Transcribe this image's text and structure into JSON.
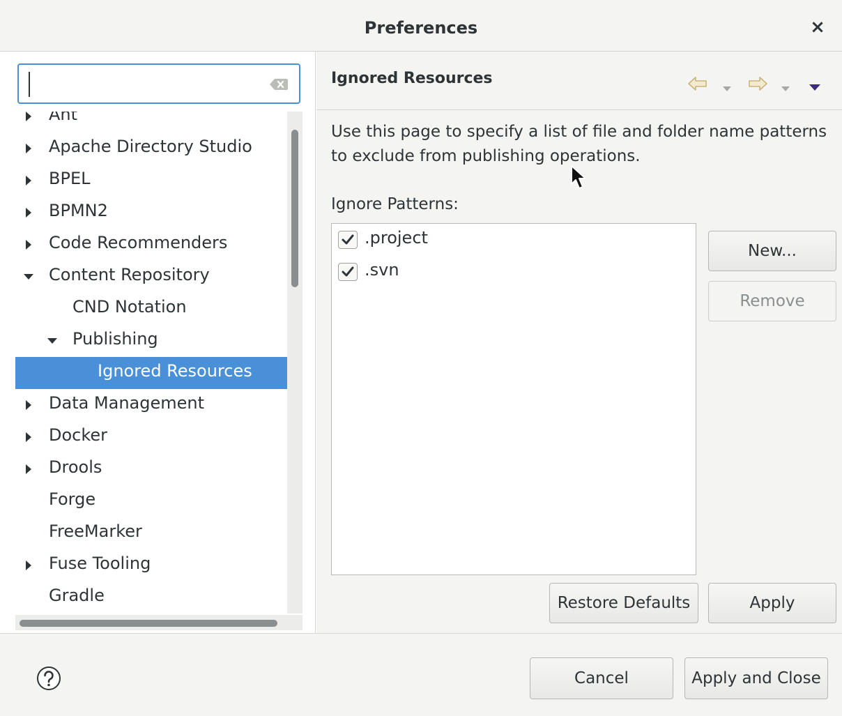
{
  "window": {
    "title": "Preferences",
    "close_glyph": "×"
  },
  "search": {
    "value": "",
    "clear_icon": "clear-text-icon"
  },
  "tree": {
    "items": [
      {
        "label": "Ant",
        "level": 0,
        "arrow": "collapsed"
      },
      {
        "label": "Apache Directory Studio",
        "level": 0,
        "arrow": "collapsed"
      },
      {
        "label": "BPEL",
        "level": 0,
        "arrow": "collapsed"
      },
      {
        "label": "BPMN2",
        "level": 0,
        "arrow": "collapsed"
      },
      {
        "label": "Code Recommenders",
        "level": 0,
        "arrow": "collapsed"
      },
      {
        "label": "Content Repository",
        "level": 0,
        "arrow": "expanded"
      },
      {
        "label": "CND Notation",
        "level": 1,
        "arrow": "none"
      },
      {
        "label": "Publishing",
        "level": 1,
        "arrow": "expanded"
      },
      {
        "label": "Ignored Resources",
        "level": 2,
        "arrow": "none",
        "selected": true
      },
      {
        "label": "Data Management",
        "level": 0,
        "arrow": "collapsed"
      },
      {
        "label": "Docker",
        "level": 0,
        "arrow": "collapsed"
      },
      {
        "label": "Drools",
        "level": 0,
        "arrow": "collapsed"
      },
      {
        "label": "Forge",
        "level": 0,
        "arrow": "none"
      },
      {
        "label": "FreeMarker",
        "level": 0,
        "arrow": "none"
      },
      {
        "label": "Fuse Tooling",
        "level": 0,
        "arrow": "collapsed"
      },
      {
        "label": "Gradle",
        "level": 0,
        "arrow": "none"
      }
    ]
  },
  "page": {
    "title": "Ignored Resources",
    "description": "Use this page to specify a list of file and folder name patterns to exclude from publishing operations.",
    "patterns_label": "Ignore Patterns:",
    "patterns": [
      {
        "label": ".project",
        "checked": true
      },
      {
        "label": ".svn",
        "checked": true
      }
    ],
    "new_button": "New...",
    "remove_button": "Remove",
    "restore_defaults_button": "Restore Defaults",
    "apply_button": "Apply"
  },
  "footer": {
    "cancel_button": "Cancel",
    "apply_close_button": "Apply and Close"
  },
  "colors": {
    "accent": "#4a90d9",
    "nav_arrow": "#d7c27a",
    "menu_arrow": "#3c2b7a"
  }
}
